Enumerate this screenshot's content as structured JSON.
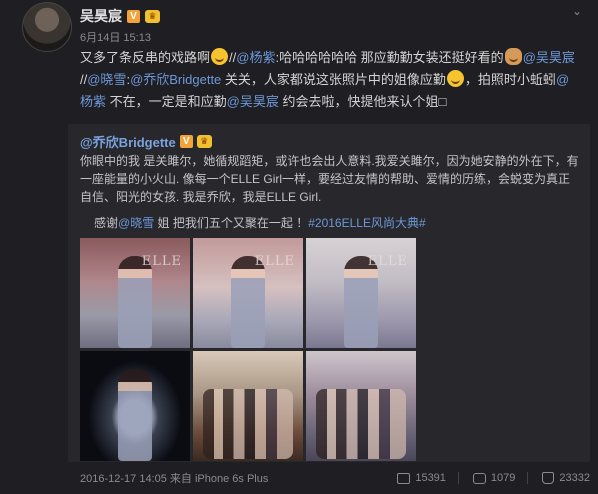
{
  "post": {
    "author": "吴昊宸",
    "time": "6月14日 15:13",
    "text_1": "又多了条反串的戏路啊",
    "text_2": "//",
    "mention_yangzi": "@杨紫",
    "text_3": ":哈哈哈哈哈哈 那应勤勤女装还挺好看的",
    "mention_whc": "@吴昊宸",
    "text_4": " //",
    "mention_xiaoxue": "@晓雪",
    "text_5": ":",
    "mention_qiaoxin": "@乔欣Bridgette",
    "text_6": " 关关，人家都说这张照片中的姐像应勤",
    "text_7": "，拍照时小蚯蚓",
    "mention_yangzi2": "@杨紫",
    "text_8": " 不在，一定是和应勤",
    "mention_whc2": "@吴昊宸",
    "text_9": " 约会去啦，快提他来认个姐□"
  },
  "retweet": {
    "author": "@乔欣Bridgette",
    "text": "你眼中的我 是关雎尔，她循规蹈矩，或许也会出人意料.我爱关雎尔，因为她安静的外在下，有一座能量的小火山. 像每一个ELLE Girl一样，要经过友情的帮助、爱情的历练，会蜕变为真正自信、阳光的女孩. 我是乔欣，我是ELLE Girl.",
    "thanks_1": "感谢",
    "thanks_mention": "@晓雪",
    "thanks_2": " 姐 把我们五个又聚在一起 ！",
    "topic": "#2016ELLE风尚大典#",
    "photo_labels": [
      "ELLE",
      "ELLE",
      "ELLE",
      "",
      "",
      ""
    ]
  },
  "footer": {
    "meta": "2016-12-17 14:05 来自 iPhone 6s Plus",
    "share_count": "15391",
    "comment_count": "1079",
    "like_count": "23332"
  },
  "icons": {
    "badge_v": "V",
    "crown": "♛",
    "chevron": "⌄"
  }
}
